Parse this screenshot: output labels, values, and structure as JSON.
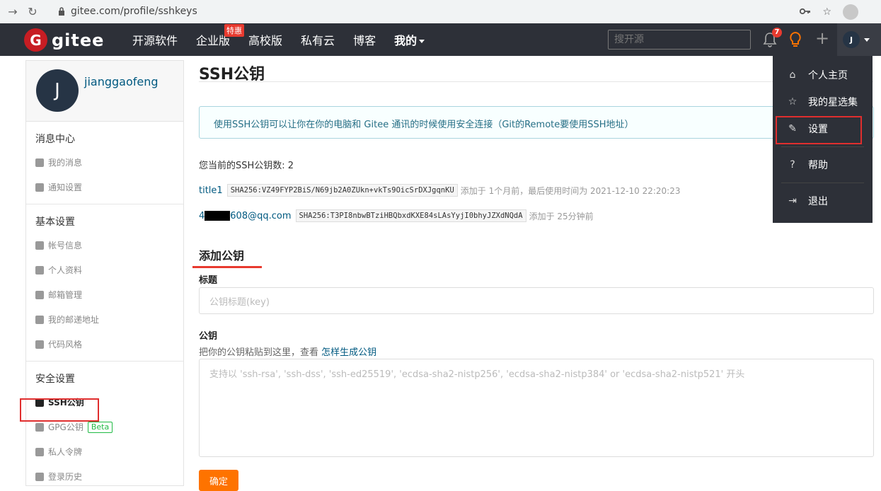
{
  "browser": {
    "url": "gitee.com/profile/sshkeys"
  },
  "topnav": {
    "logo_text": "gitee",
    "logo_letter": "G",
    "menu": [
      {
        "label": "开源软件"
      },
      {
        "label": "企业版",
        "badge": "特惠"
      },
      {
        "label": "高校版"
      },
      {
        "label": "私有云"
      },
      {
        "label": "博客"
      },
      {
        "label": "我的"
      }
    ],
    "search_placeholder": "搜开源",
    "notification_count": "7",
    "user_initial": "J"
  },
  "sidebar": {
    "avatar_initial": "J",
    "username": "jianggaofeng",
    "sections": [
      {
        "title": "消息中心",
        "items": [
          "我的消息",
          "通知设置"
        ]
      },
      {
        "title": "基本设置",
        "items": [
          "帐号信息",
          "个人资料",
          "邮箱管理",
          "我的邮递地址",
          "代码风格"
        ]
      },
      {
        "title": "安全设置",
        "items": [
          "SSH公钥",
          "GPG公钥",
          "私人令牌",
          "登录历史"
        ]
      }
    ],
    "beta_label": "Beta"
  },
  "main": {
    "page_title": "SSH公钥",
    "info": "使用SSH公钥可以让你在你的电脑和 Gitee 通讯的时候使用安全连接（Git的Remote要使用SSH地址）",
    "count_text": "您当前的SSH公钥数: 2",
    "keys": [
      {
        "name": "title1",
        "fingerprint": "SHA256:VZ49FYP2BiS/N69jb2A0ZUkn+vkTs9OicSrDXJgqnKU",
        "meta": "添加于 1个月前，最后使用时间为 2021-12-10 22:20:23"
      },
      {
        "name_prefix": "4",
        "name_suffix": "608@qq.com",
        "fingerprint": "SHA256:T3PI8nbwBTziHBQbxdKXE84sLAsYyjI0bhyJZXdNQdA",
        "meta": "添加于 25分钟前"
      }
    ],
    "add_title": "添加公钥",
    "title_label": "标题",
    "title_placeholder": "公钥标题(key)",
    "key_label": "公钥",
    "key_hint": "把你的公钥粘贴到这里，查看",
    "key_hint_link": "怎样生成公钥",
    "key_placeholder": "支持以 'ssh-rsa', 'ssh-dss', 'ssh-ed25519', 'ecdsa-sha2-nistp256', 'ecdsa-sha2-nistp384' or 'ecdsa-sha2-nistp521' 开头",
    "submit_label": "确定"
  },
  "dropdown": {
    "items": [
      {
        "label": "个人主页",
        "icon": "home-icon"
      },
      {
        "label": "我的星选集",
        "icon": "star-icon"
      },
      {
        "label": "设置",
        "icon": "edit-icon"
      },
      {
        "label": "帮助",
        "icon": "help-icon"
      },
      {
        "label": "退出",
        "icon": "logout-icon"
      }
    ]
  },
  "colors": {
    "nav_bg": "#2d3038",
    "brand_red": "#c71d23",
    "accent_orange": "#fe7300",
    "link_blue": "#005980",
    "highlight_red": "#e02e2e"
  }
}
